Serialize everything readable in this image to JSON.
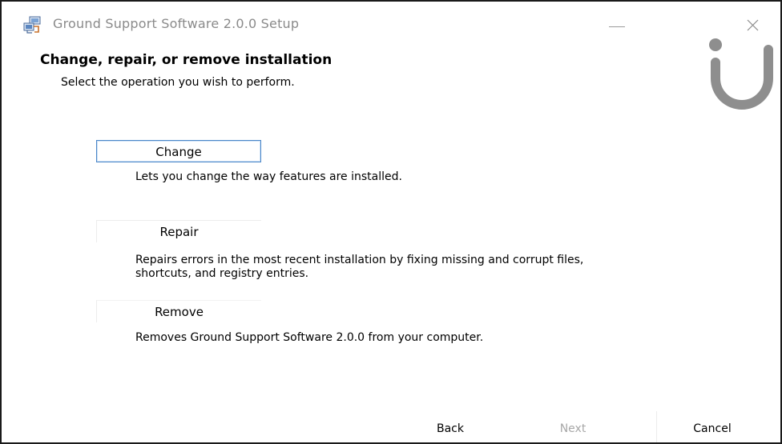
{
  "window": {
    "title": "Ground Support Software 2.0.0 Setup"
  },
  "header": {
    "title": "Change, repair, or remove installation",
    "subtitle": "Select the operation you wish to perform."
  },
  "options": [
    {
      "label": "Change",
      "description": "Lets you change the way features are installed."
    },
    {
      "label": "Repair",
      "description_line1": "Repairs errors in the most recent installation by fixing missing and corrupt files,",
      "description_line2": "shortcuts, and registry entries."
    },
    {
      "label": "Remove",
      "description": "Removes Ground Support Software 2.0.0 from your computer."
    }
  ],
  "footer": {
    "back_label": "Back",
    "next_label": "Next",
    "cancel_label": "Cancel"
  },
  "icons": {
    "app": "installer-icon",
    "minimize": "minimize-icon",
    "close": "close-icon",
    "brand": "brand-logo"
  },
  "colors": {
    "logo": "#8e8e8e",
    "focus_border": "#4a86c8",
    "disabled_text": "#a8a8a8"
  }
}
